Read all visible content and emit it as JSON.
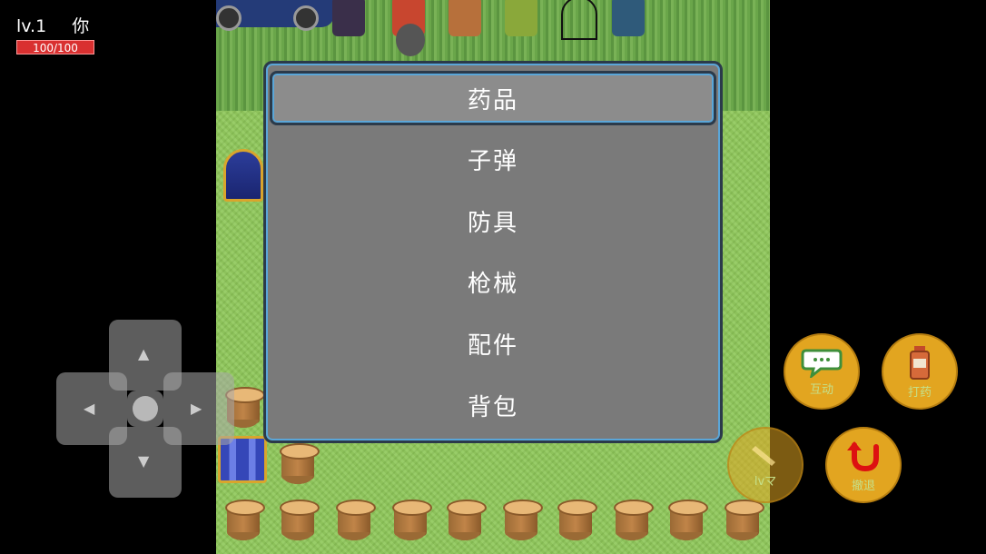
{
  "hud": {
    "level": "lv.1",
    "player_name": "你",
    "hp_text": "100/100"
  },
  "menu": {
    "items": [
      {
        "label": "药品",
        "selected": true
      },
      {
        "label": "子弹",
        "selected": false
      },
      {
        "label": "防具",
        "selected": false
      },
      {
        "label": "枪械",
        "selected": false
      },
      {
        "label": "配件",
        "selected": false
      },
      {
        "label": "背包",
        "selected": false
      }
    ]
  },
  "controls": {
    "interact_label": "互动",
    "heal_label": "打药",
    "attack_label": "lvマ",
    "retreat_label": "撤退"
  },
  "colors": {
    "hp_bar": "#d93030",
    "menu_bg": "#7a7a7a",
    "button_orange": "#e2a520",
    "grass": "#8fc85a"
  },
  "icons": {
    "dpad_up": "triangle-up-icon",
    "dpad_down": "triangle-down-icon",
    "dpad_left": "triangle-left-icon",
    "dpad_right": "triangle-right-icon",
    "interact": "speech-bubble-icon",
    "heal": "medicine-bottle-icon",
    "attack": "pencil-icon",
    "retreat": "u-turn-arrow-icon"
  }
}
